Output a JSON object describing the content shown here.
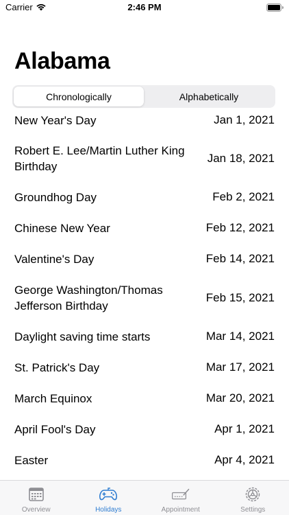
{
  "status_bar": {
    "carrier": "Carrier",
    "time": "2:46 PM"
  },
  "title": "Alabama",
  "segmented": {
    "options": [
      "Chronologically",
      "Alphabetically"
    ],
    "selected": "Chronologically"
  },
  "holidays": [
    {
      "name": "New Year's Day",
      "date": "Jan 1, 2021"
    },
    {
      "name": "Robert E. Lee/Martin Luther King Birthday",
      "date": "Jan 18, 2021"
    },
    {
      "name": "Groundhog Day",
      "date": "Feb 2, 2021"
    },
    {
      "name": "Chinese New Year",
      "date": "Feb 12, 2021"
    },
    {
      "name": "Valentine's Day",
      "date": "Feb 14, 2021"
    },
    {
      "name": "George Washington/Thomas Jefferson Birthday",
      "date": "Feb 15, 2021"
    },
    {
      "name": "Daylight saving time starts",
      "date": "Mar 14, 2021"
    },
    {
      "name": "St. Patrick's Day",
      "date": "Mar 17, 2021"
    },
    {
      "name": "March Equinox",
      "date": "Mar 20, 2021"
    },
    {
      "name": "April Fool's Day",
      "date": "Apr 1, 2021"
    },
    {
      "name": "Easter",
      "date": "Apr 4, 2021"
    }
  ],
  "tab_bar": {
    "tabs": [
      {
        "label": "Overview",
        "icon": "calendar-icon"
      },
      {
        "label": "Holidays",
        "icon": "gamepad-icon"
      },
      {
        "label": "Appointment",
        "icon": "signature-icon"
      },
      {
        "label": "Settings",
        "icon": "gear-icon"
      }
    ],
    "active": "Holidays"
  },
  "colors": {
    "accent": "#2f7dd1",
    "inactive_tab": "#8e8e93",
    "segment_background": "#eeeef0"
  }
}
